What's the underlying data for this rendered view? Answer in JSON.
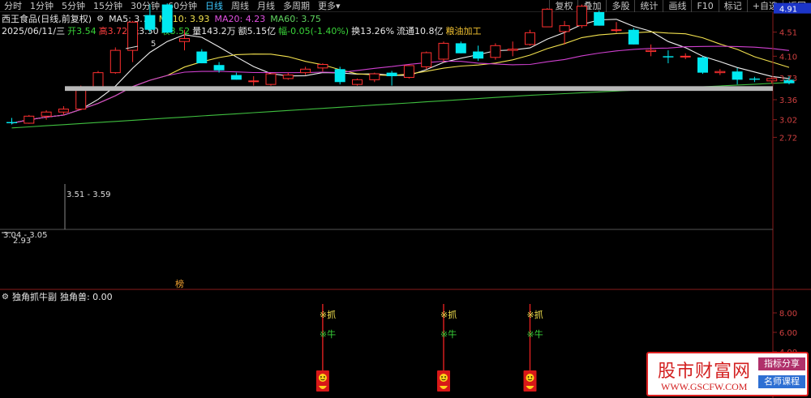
{
  "toolbar": {
    "timeframes": [
      {
        "label": "分时",
        "name": "tab-timeshare"
      },
      {
        "label": "1分钟",
        "name": "tab-1min"
      },
      {
        "label": "5分钟",
        "name": "tab-5min"
      },
      {
        "label": "15分钟",
        "name": "tab-15min"
      },
      {
        "label": "30分钟",
        "name": "tab-30min"
      },
      {
        "label": "60分钟",
        "name": "tab-60min"
      },
      {
        "label": "日线",
        "name": "tab-daily",
        "active": true
      },
      {
        "label": "周线",
        "name": "tab-weekly"
      },
      {
        "label": "月线",
        "name": "tab-monthly"
      },
      {
        "label": "多周期",
        "name": "tab-multi-period"
      }
    ],
    "more_label": "更多",
    "tools": [
      "复权",
      "叠加",
      "多股",
      "统计",
      "画线",
      "F10",
      "标记",
      "+自选",
      "返回"
    ]
  },
  "header": {
    "stock_name": "西王食品(日线,前复权)",
    "ma5_label": "MA5: 3.73",
    "ma10_label": "MA10: 3.93",
    "ma20_label": "MA20: 4.23",
    "ma60_label": "MA60: 3.75",
    "date": "2025/06/11/三",
    "open": "开3.54",
    "high": "高3.72",
    "low": "低3.50",
    "close": "收3.52",
    "volume": "量143.2万",
    "amount": "额5.15亿",
    "change": "幅-0.05(-1.40%)",
    "turnover": "换13.26%",
    "float": "流通10.8亿",
    "sector": "粮油加工"
  },
  "chart_data": {
    "type": "candlestick",
    "y_ticks": [
      "4.91",
      "4.51",
      "4.10",
      "3.73",
      "3.36",
      "3.02",
      "2.72"
    ],
    "y_tick_values": [
      4.91,
      4.51,
      4.1,
      3.73,
      3.36,
      3.02,
      2.72
    ],
    "current_price_label": "4.91",
    "candles": [
      [
        2.98,
        3.05,
        2.94,
        2.96
      ],
      [
        2.96,
        3.1,
        2.95,
        3.08
      ],
      [
        3.08,
        3.18,
        3.02,
        3.15
      ],
      [
        3.15,
        3.25,
        3.1,
        3.2
      ],
      [
        3.2,
        3.6,
        3.18,
        3.58
      ],
      [
        3.58,
        3.85,
        3.55,
        3.82
      ],
      [
        3.82,
        4.25,
        3.8,
        4.2
      ],
      [
        4.2,
        4.7,
        4.0,
        4.68
      ],
      [
        4.8,
        4.98,
        4.5,
        4.55
      ],
      [
        4.98,
        5.0,
        4.5,
        4.5
      ],
      [
        4.35,
        4.55,
        4.2,
        4.4
      ],
      [
        4.18,
        4.22,
        3.98,
        3.98
      ],
      [
        3.95,
        4.0,
        3.82,
        3.86
      ],
      [
        3.78,
        3.82,
        3.7,
        3.7
      ],
      [
        3.68,
        3.76,
        3.6,
        3.68
      ],
      [
        3.62,
        3.8,
        3.6,
        3.8
      ],
      [
        3.72,
        3.82,
        3.7,
        3.78
      ],
      [
        3.82,
        3.92,
        3.78,
        3.88
      ],
      [
        3.9,
        3.98,
        3.84,
        3.96
      ],
      [
        3.88,
        3.92,
        3.62,
        3.66
      ],
      [
        3.62,
        3.72,
        3.6,
        3.7
      ],
      [
        3.7,
        3.82,
        3.66,
        3.8
      ],
      [
        3.82,
        3.85,
        3.6,
        3.76
      ],
      [
        3.74,
        3.95,
        3.72,
        3.94
      ],
      [
        3.92,
        4.18,
        3.88,
        4.16
      ],
      [
        4.05,
        4.35,
        4.0,
        4.32
      ],
      [
        4.32,
        4.35,
        4.15,
        4.15
      ],
      [
        4.18,
        4.28,
        4.02,
        4.06
      ],
      [
        4.08,
        4.32,
        4.04,
        4.28
      ],
      [
        4.2,
        4.35,
        4.1,
        4.22
      ],
      [
        4.3,
        4.55,
        4.28,
        4.5
      ],
      [
        4.6,
        4.92,
        4.6,
        4.9
      ],
      [
        4.52,
        4.7,
        4.3,
        4.62
      ],
      [
        4.62,
        4.98,
        4.58,
        4.95
      ],
      [
        4.85,
        4.88,
        4.62,
        4.62
      ],
      [
        4.55,
        4.68,
        4.5,
        4.55
      ],
      [
        4.55,
        4.58,
        4.3,
        4.3
      ],
      [
        4.18,
        4.3,
        4.1,
        4.2
      ],
      [
        4.1,
        4.2,
        3.98,
        4.08
      ],
      [
        4.1,
        4.15,
        4.05,
        4.1
      ],
      [
        4.08,
        4.1,
        3.8,
        3.82
      ],
      [
        3.82,
        3.88,
        3.78,
        3.84
      ],
      [
        3.84,
        3.9,
        3.62,
        3.7
      ],
      [
        3.72,
        3.75,
        3.66,
        3.7
      ],
      [
        3.68,
        3.74,
        3.64,
        3.72
      ],
      [
        3.7,
        3.76,
        3.62,
        3.64
      ]
    ],
    "support_zone": {
      "low": 3.51,
      "high": 3.59
    },
    "annotations": {
      "support_label": "3.51 - 3.59",
      "low_label_1": "3.04 - 3.05",
      "low_label_2": "2.93",
      "high_marker": "5",
      "badge": "榜"
    }
  },
  "sub_panel": {
    "title": "独角抓牛副",
    "value_label": "独角兽: 0.00",
    "y_ticks": [
      "8.00",
      "6.00",
      "4.00"
    ],
    "signal_text_top": "※抓",
    "signal_text_bottom": "※牛",
    "signal_indices": [
      18,
      25,
      30
    ]
  },
  "watermark": {
    "site_name": "股市财富网",
    "url": "WWW.GSCFW.COM",
    "tag1": "指标分享",
    "tag2": "名师课程"
  }
}
